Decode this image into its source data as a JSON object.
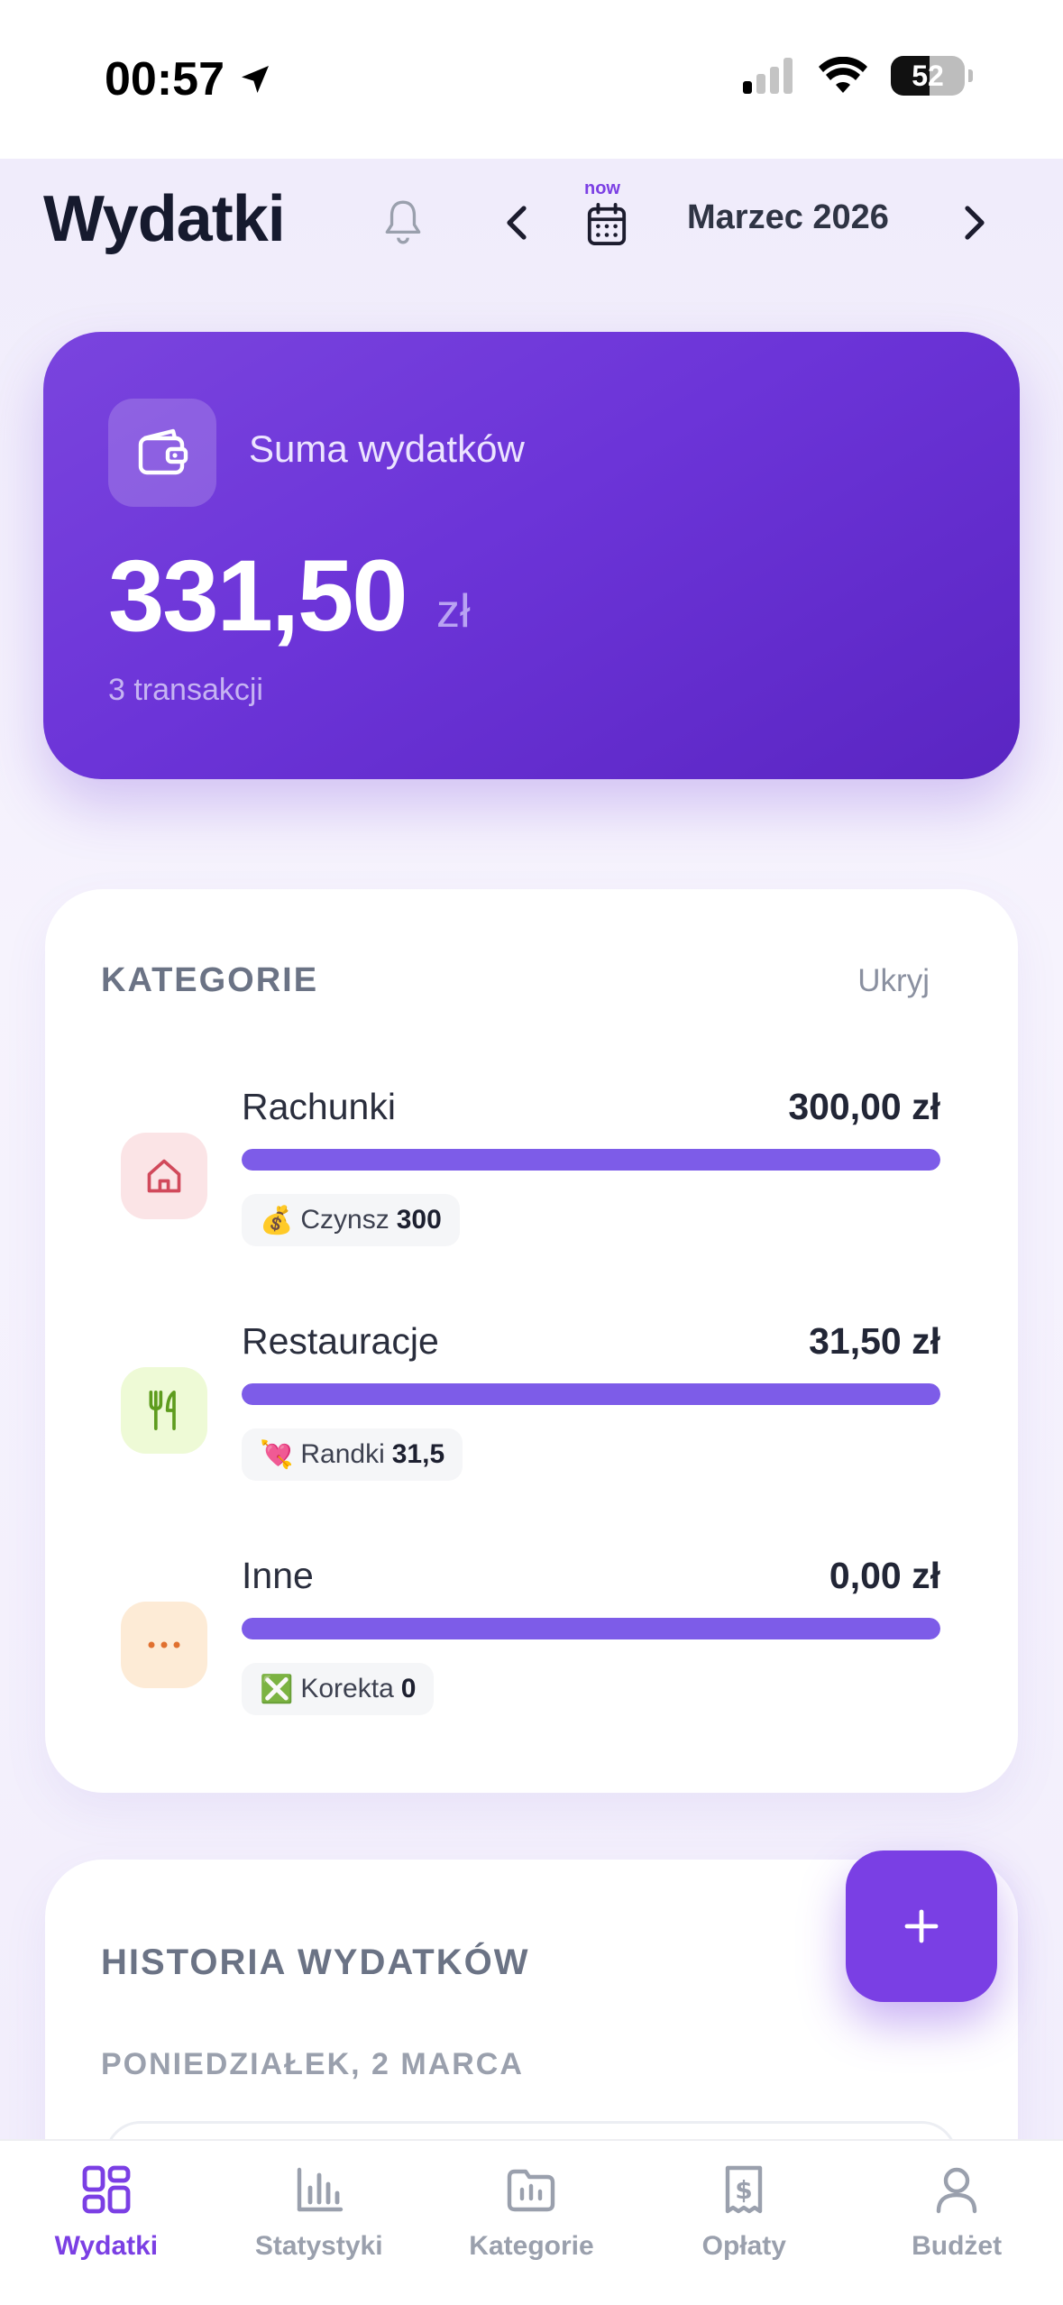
{
  "status_bar": {
    "time": "00:57",
    "battery": "52"
  },
  "header": {
    "title": "Wydatki",
    "now_label": "now",
    "month": "Marzec 2026"
  },
  "summary": {
    "label": "Suma wydatków",
    "amount": "331,50",
    "currency": "zł",
    "count": "3 transakcji"
  },
  "categories": {
    "title": "KATEGORIE",
    "hide_label": "Ukryj",
    "items": [
      {
        "name": "Rachunki",
        "amount": "300,00 zł",
        "share": 1.0,
        "tag_emoji": "💰",
        "tag_name": "Czynsz",
        "tag_value": "300",
        "icon": "home-icon",
        "icon_bg": "#fbe4e6",
        "icon_color": "#d1495b"
      },
      {
        "name": "Restauracje",
        "amount": "31,50 zł",
        "share": 1.0,
        "tag_emoji": "💘",
        "tag_name": "Randki",
        "tag_value": "31,5",
        "icon": "utensils-icon",
        "icon_bg": "#eefad6",
        "icon_color": "#5e9c1e"
      },
      {
        "name": "Inne",
        "amount": "0,00 zł",
        "share": 1.0,
        "tag_emoji": "❎",
        "tag_name": "Korekta",
        "tag_value": "0",
        "icon": "more-icon",
        "icon_bg": "#fdebd6",
        "icon_color": "#e0702f"
      }
    ]
  },
  "history": {
    "title": "HISTORIA WYDATKÓW",
    "date_heading": "PONIEDZIAŁEK, 2 MARCA"
  },
  "fab": {
    "label": "+"
  },
  "nav": {
    "items": [
      {
        "label": "Wydatki",
        "icon": "grid-icon",
        "active": true
      },
      {
        "label": "Statystyki",
        "icon": "bar-chart-icon",
        "active": false
      },
      {
        "label": "Kategorie",
        "icon": "folder-icon",
        "active": false
      },
      {
        "label": "Opłaty",
        "icon": "receipt-icon",
        "active": false
      },
      {
        "label": "Budżet",
        "icon": "user-icon",
        "active": false
      }
    ]
  },
  "colors": {
    "accent": "#7a3fe4",
    "bar": "#7d5ce8"
  }
}
